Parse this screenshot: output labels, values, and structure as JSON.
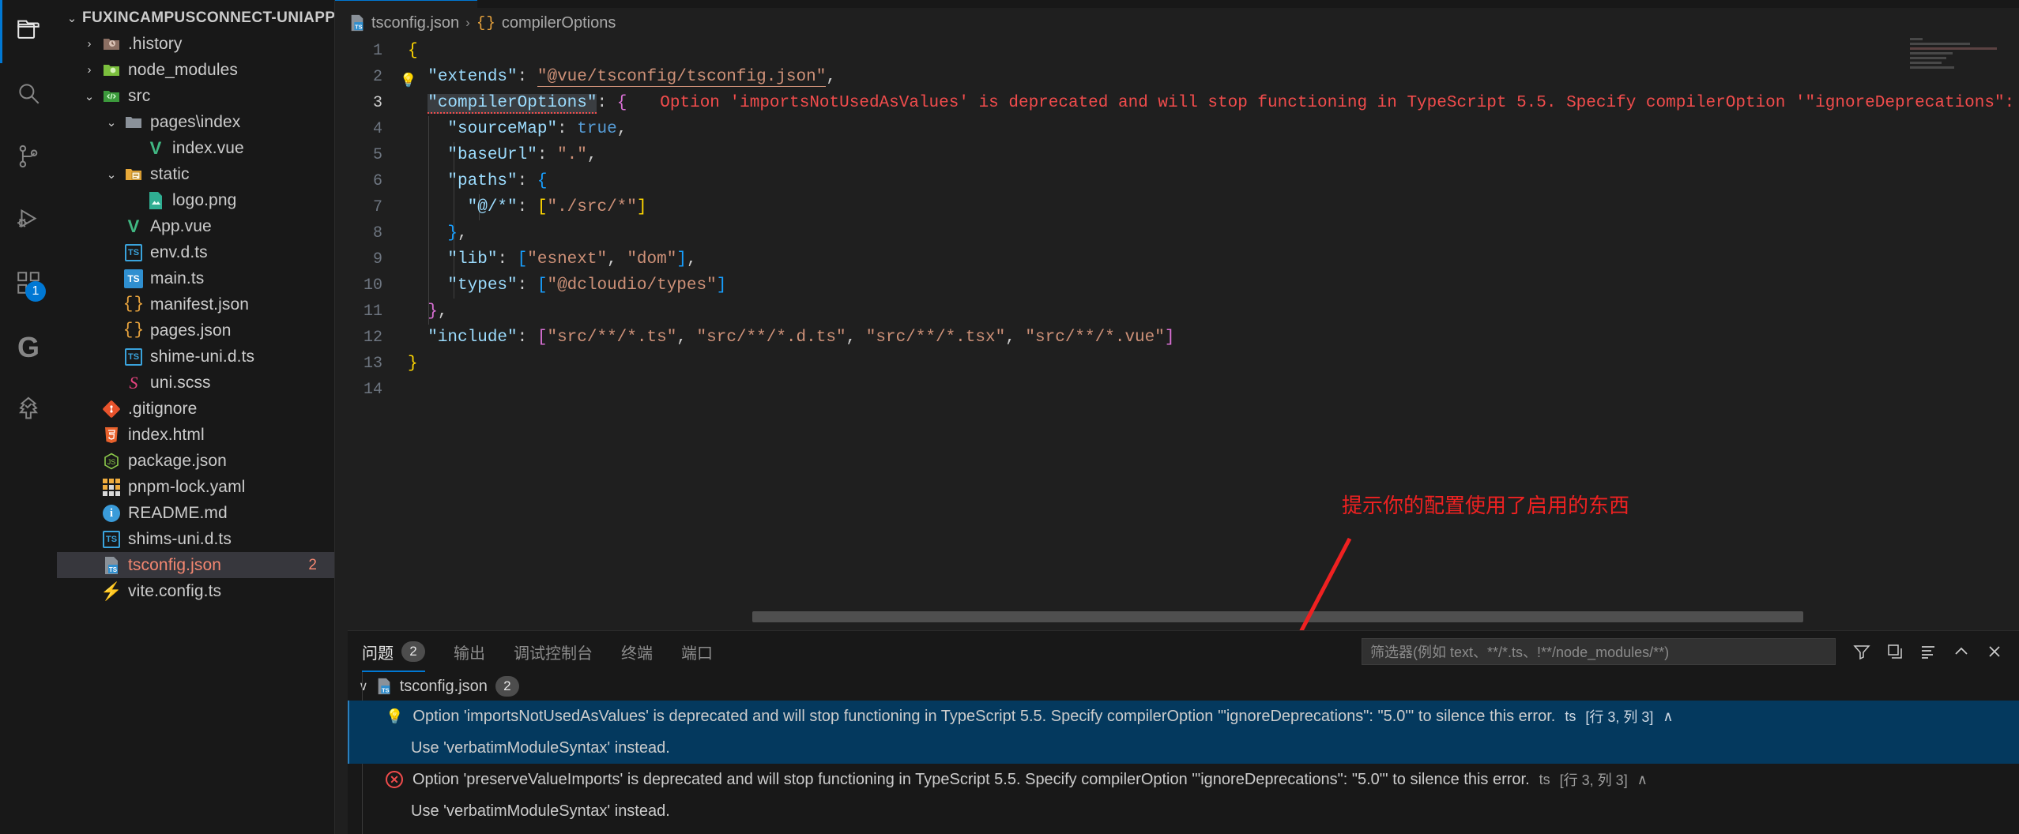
{
  "activitybar": {
    "items": [
      {
        "name": "explorer",
        "icon": "files-icon",
        "active": true
      },
      {
        "name": "search",
        "icon": "search-icon",
        "active": false
      },
      {
        "name": "source-control",
        "icon": "source-control-icon",
        "active": false
      },
      {
        "name": "run-and-debug",
        "icon": "run-debug-icon",
        "active": false
      },
      {
        "name": "extensions",
        "icon": "extensions-icon",
        "active": false,
        "badge": "1"
      },
      {
        "name": "gitlens",
        "icon": "gitlens-g-icon",
        "active": false
      },
      {
        "name": "todo-tree",
        "icon": "tree-check-icon",
        "active": false
      }
    ]
  },
  "sidebar": {
    "root_label": "FUXINCAMPUSCONNECT-UNIAPP-TS",
    "items": [
      {
        "label": ".history",
        "icon": "folder-history-icon",
        "depth": 1,
        "twisty": "collapsed"
      },
      {
        "label": "node_modules",
        "icon": "folder-node-icon",
        "depth": 1,
        "twisty": "collapsed"
      },
      {
        "label": "src",
        "icon": "folder-src-icon",
        "depth": 1,
        "twisty": "expanded"
      },
      {
        "label": "pages\\index",
        "icon": "folder-icon",
        "depth": 2,
        "twisty": "expanded"
      },
      {
        "label": "index.vue",
        "icon": "vue-icon",
        "depth": 3,
        "twisty": "none"
      },
      {
        "label": "static",
        "icon": "folder-static-icon",
        "depth": 2,
        "twisty": "expanded"
      },
      {
        "label": "logo.png",
        "icon": "image-icon",
        "depth": 3,
        "twisty": "none"
      },
      {
        "label": "App.vue",
        "icon": "vue-icon",
        "depth": 2,
        "twisty": "none"
      },
      {
        "label": "env.d.ts",
        "icon": "ts-def-icon",
        "depth": 2,
        "twisty": "none"
      },
      {
        "label": "main.ts",
        "icon": "ts-icon",
        "depth": 2,
        "twisty": "none"
      },
      {
        "label": "manifest.json",
        "icon": "json-icon",
        "depth": 2,
        "twisty": "none"
      },
      {
        "label": "pages.json",
        "icon": "json-icon",
        "depth": 2,
        "twisty": "none"
      },
      {
        "label": "shime-uni.d.ts",
        "icon": "ts-def-icon",
        "depth": 2,
        "twisty": "none"
      },
      {
        "label": "uni.scss",
        "icon": "scss-icon",
        "depth": 2,
        "twisty": "none"
      },
      {
        "label": ".gitignore",
        "icon": "git-icon",
        "depth": 1,
        "twisty": "none"
      },
      {
        "label": "index.html",
        "icon": "html-icon",
        "depth": 1,
        "twisty": "none"
      },
      {
        "label": "package.json",
        "icon": "npm-icon",
        "depth": 1,
        "twisty": "none"
      },
      {
        "label": "pnpm-lock.yaml",
        "icon": "yaml-icon",
        "depth": 1,
        "twisty": "none"
      },
      {
        "label": "README.md",
        "icon": "readme-icon",
        "depth": 1,
        "twisty": "none"
      },
      {
        "label": "shims-uni.d.ts",
        "icon": "ts-def-icon",
        "depth": 1,
        "twisty": "none"
      },
      {
        "label": "tsconfig.json",
        "icon": "tsconfig-icon",
        "depth": 1,
        "twisty": "none",
        "selected": true,
        "badge": "2"
      },
      {
        "label": "vite.config.ts",
        "icon": "vite-icon",
        "depth": 1,
        "twisty": "none"
      }
    ]
  },
  "editor": {
    "breadcrumb": {
      "file_icon": "tsconfig-icon",
      "file": "tsconfig.json",
      "separator": "›",
      "symbol_icon": "braces-icon",
      "symbol": "compilerOptions"
    },
    "line_numbers": [
      "1",
      "2",
      "3",
      "4",
      "5",
      "6",
      "7",
      "8",
      "9",
      "10",
      "11",
      "12",
      "13",
      "14"
    ],
    "current_line": "3",
    "inline_error": "Option 'importsNotUsedAsValues' is deprecated and will stop functioning in TypeScript 5.5. Specify compilerOption '\"ignoreDeprecations\": \"",
    "code": [
      "{",
      "  \"extends\": \"@vue/tsconfig/tsconfig.json\",",
      "  \"compilerOptions\": {",
      "    \"sourceMap\": true,",
      "    \"baseUrl\": \".\",",
      "    \"paths\": {",
      "      \"@/*\": [\"./src/*\"]",
      "    },",
      "    \"lib\": [\"esnext\", \"dom\"],",
      "    \"types\": [\"@dcloudio/types\"]",
      "  },",
      "  \"include\": [\"src/**/*.ts\", \"src/**/*.d.ts\", \"src/**/*.tsx\", \"src/**/*.vue\"]",
      "}",
      ""
    ]
  },
  "annotation": {
    "text": "提示你的配置使用了启用的东西",
    "color": "#ef2121"
  },
  "panel": {
    "tabs": [
      {
        "label": "问题",
        "badge": "2",
        "active": true
      },
      {
        "label": "输出",
        "badge": "",
        "active": false
      },
      {
        "label": "调试控制台",
        "badge": "",
        "active": false
      },
      {
        "label": "终端",
        "badge": "",
        "active": false
      },
      {
        "label": "端口",
        "badge": "",
        "active": false
      }
    ],
    "filter": {
      "value": "",
      "placeholder": "筛选器(例如 text、**/*.ts、!**/node_modules/**)"
    },
    "actions": [
      {
        "name": "filter-icon",
        "glyph": "▽"
      },
      {
        "name": "collapse-all-icon",
        "glyph": "❐"
      },
      {
        "name": "view-as-list-icon",
        "glyph": "≡"
      },
      {
        "name": "chevron-up-icon",
        "glyph": "∧"
      },
      {
        "name": "close-panel-icon",
        "glyph": "✕"
      }
    ],
    "group": {
      "file_icon": "tsconfig-icon",
      "file": "tsconfig.json",
      "badge": "2",
      "twisty": "∨"
    },
    "problems": [
      {
        "severity": "warning",
        "icon": "lightbulb-icon",
        "message": "Option 'importsNotUsedAsValues' is deprecated and will stop functioning in TypeScript 5.5. Specify compilerOption '\"ignoreDeprecations\": \"5.0\"' to silence this error.",
        "source": "ts",
        "position": "[行 3, 列 3]",
        "chevron": "∧",
        "selected": true,
        "detail": "Use 'verbatimModuleSyntax' instead."
      },
      {
        "severity": "error",
        "icon": "error-circle-icon",
        "message": "Option 'preserveValueImports' is deprecated and will stop functioning in TypeScript 5.5. Specify compilerOption '\"ignoreDeprecations\": \"5.0\"' to silence this error.",
        "source": "ts",
        "position": "[行 3, 列 3]",
        "chevron": "∧",
        "selected": false,
        "detail": "Use 'verbatimModuleSyntax' instead."
      }
    ]
  }
}
